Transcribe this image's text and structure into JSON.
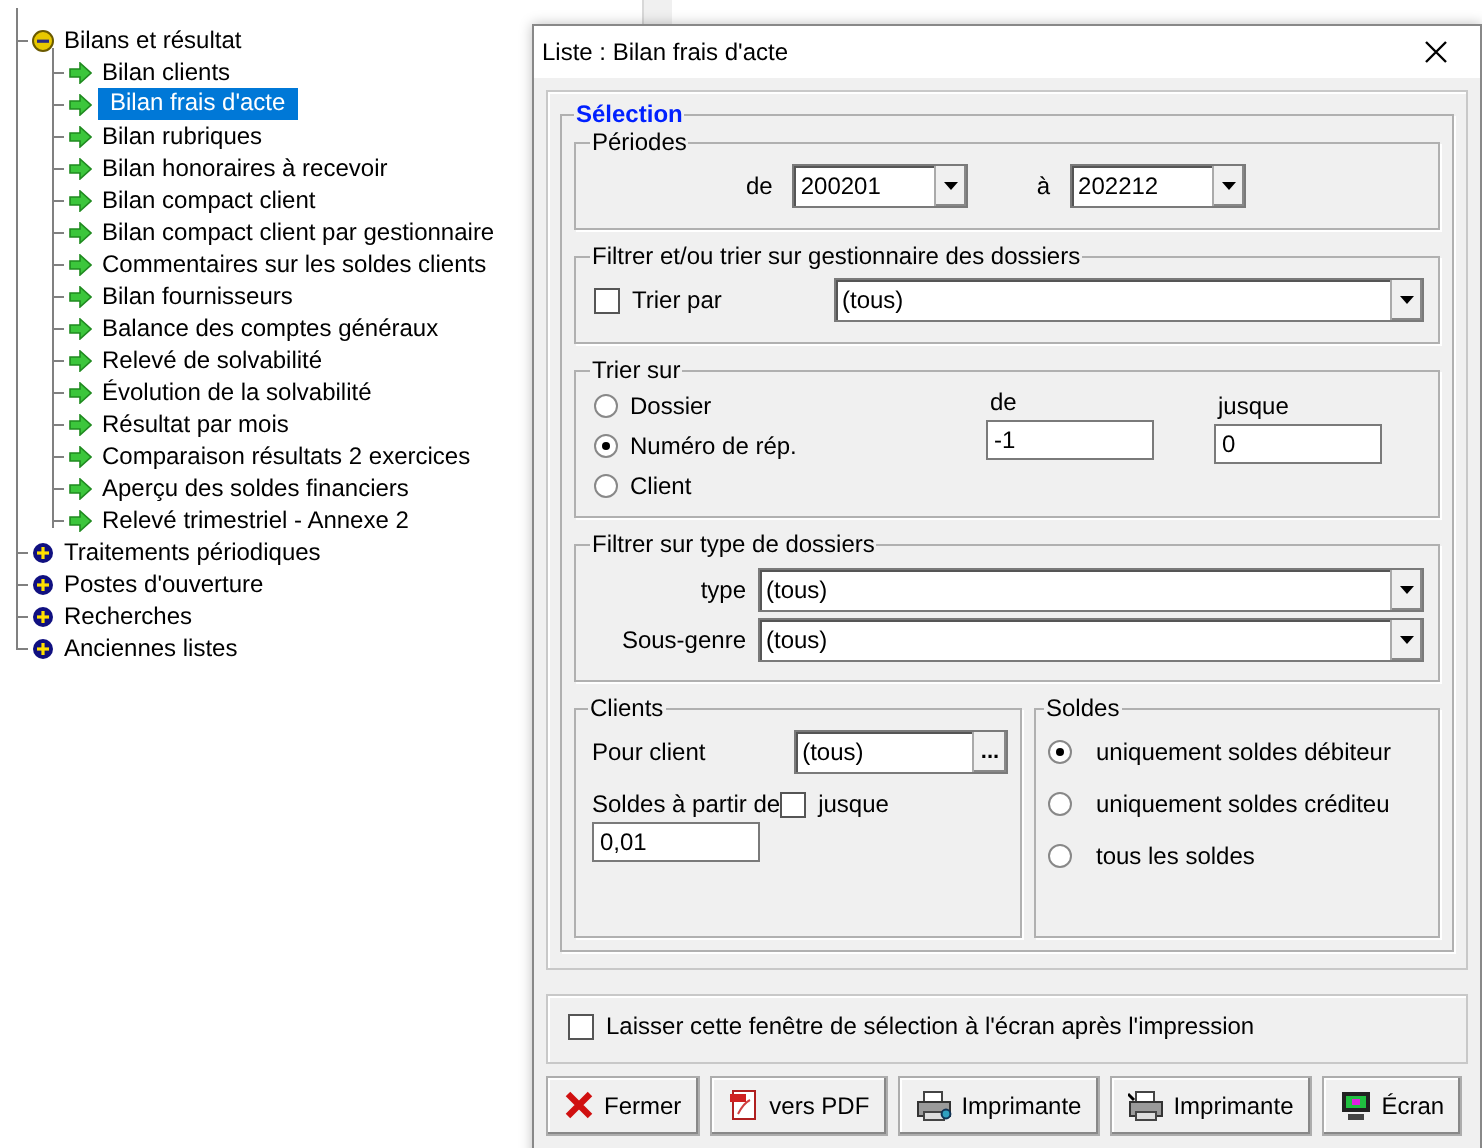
{
  "tree": [
    {
      "label": "Bilans et résultat",
      "expanded": true,
      "children": [
        {
          "label": "Bilan clients",
          "selected": false
        },
        {
          "label": "Bilan frais d'acte",
          "selected": true
        },
        {
          "label": "Bilan rubriques",
          "selected": false
        },
        {
          "label": "Bilan honoraires à recevoir",
          "selected": false
        },
        {
          "label": "Bilan compact client",
          "selected": false
        },
        {
          "label": "Bilan compact client par gestionnaire",
          "selected": false
        },
        {
          "label": "Commentaires sur les soldes clients",
          "selected": false
        },
        {
          "label": "Bilan fournisseurs",
          "selected": false
        },
        {
          "label": "Balance des comptes généraux",
          "selected": false
        },
        {
          "label": "Relevé de solvabilité",
          "selected": false
        },
        {
          "label": "Évolution de la solvabilité",
          "selected": false
        },
        {
          "label": "Résultat par mois",
          "selected": false
        },
        {
          "label": "Comparaison résultats 2 exercices",
          "selected": false
        },
        {
          "label": "Aperçu des soldes financiers",
          "selected": false
        },
        {
          "label": "Relevé trimestriel - Annexe 2",
          "selected": false
        }
      ]
    },
    {
      "label": "Traitements périodiques",
      "expanded": false
    },
    {
      "label": "Postes d'ouverture",
      "expanded": false
    },
    {
      "label": "Recherches",
      "expanded": false
    },
    {
      "label": "Anciennes listes",
      "expanded": false
    }
  ],
  "dialog": {
    "title": "Liste : Bilan frais d'acte",
    "selection_legend": "Sélection",
    "periodes": {
      "legend": "Périodes",
      "from_label": "de",
      "from_value": "200201",
      "to_label": "à",
      "to_value": "202212"
    },
    "gestionnaire": {
      "legend": "Filtrer et/ou trier sur gestionnaire des dossiers",
      "checkbox": {
        "label": "Trier par",
        "checked": false
      },
      "value": "(tous)"
    },
    "trier_sur": {
      "legend": "Trier sur",
      "options": [
        {
          "label": "Dossier",
          "selected": false
        },
        {
          "label": "Numéro de rép.",
          "selected": true
        },
        {
          "label": "Client",
          "selected": false
        }
      ],
      "from_label": "de",
      "from_value": "-1",
      "to_label": "jusque",
      "to_value": "0"
    },
    "type_filter": {
      "legend": "Filtrer sur type de dossiers",
      "fields": [
        {
          "label": "type",
          "value": "(tous)"
        },
        {
          "label": "Sous-genre",
          "value": "(tous)"
        }
      ]
    },
    "clients": {
      "legend": "Clients",
      "client_label": "Pour client",
      "client_value": "(tous)",
      "browse": "...",
      "soldes_label": "Soldes à partir de",
      "jusque": {
        "label": "jusque",
        "checked": false
      },
      "soldes_value": "0,01"
    },
    "soldes": {
      "legend": "Soldes",
      "options": [
        {
          "label": "uniquement soldes débiteur",
          "selected": true
        },
        {
          "label": "uniquement soldes créditeu",
          "selected": false
        },
        {
          "label": "tous les soldes",
          "selected": false
        }
      ]
    },
    "keep_open": {
      "label": "Laisser cette fenêtre de sélection à l'écran après l'impression",
      "checked": false
    },
    "buttons": [
      {
        "label": "Fermer",
        "kind": "close"
      },
      {
        "label": "vers PDF",
        "kind": "pdf"
      },
      {
        "label": "Imprimante",
        "kind": "printer"
      },
      {
        "label": "Imprimante",
        "kind": "printer-setup"
      },
      {
        "label": "Écran",
        "kind": "screen"
      }
    ]
  }
}
